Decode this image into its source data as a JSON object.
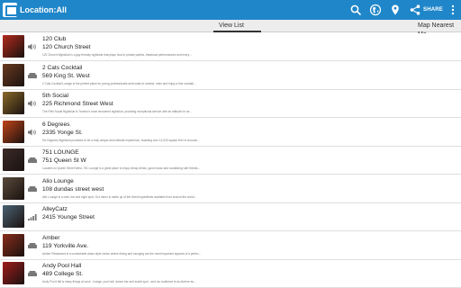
{
  "app_title": "Location:All",
  "toolbar": {
    "share_label": "SHARE"
  },
  "tabs": [
    {
      "label": "View List",
      "selected": true
    },
    {
      "label": "Map Nearest Me",
      "selected": false
    }
  ],
  "listings": [
    {
      "name": "120 Club",
      "address": "120 Church Street",
      "description": "120 Church Nightclub is a gay friendly nightclub that plays host to private parties, theatrical performances and every...",
      "type_icon": "speaker-icon",
      "thumb_color": "#b22a1c"
    },
    {
      "name": "2 Cats Cocktail",
      "address": "569 King St. West",
      "description": "2 Cats Cocktail Lounge is the perfect place for young professionals and locals to unwind, relax and enjoy a fine cocktail...",
      "type_icon": "sofa-icon",
      "thumb_color": "#6a3a20"
    },
    {
      "name": "5th Social",
      "address": "225 Richmond Street West",
      "description": "The Fifth Social Nightclub is Toronto's most renowned nightclub, providing exceptional service with an attitude for se...",
      "type_icon": "speaker-icon",
      "thumb_color": "#8a6a2a"
    },
    {
      "name": "6 Degrees",
      "address": "2335 Yonge St.",
      "description": "Six Degrees Nightclub promises to be a truly unique and intimate experience, boasting over 12,000 square feet of chocola...",
      "type_icon": "speaker-icon",
      "thumb_color": "#c04418"
    },
    {
      "name": "751 LOUNGE",
      "address": "751 Queen St W",
      "description": "Located on Queen Street West, 751 Lounge is a great place to enjoy cheap drinks, good music and socializing with friends...",
      "type_icon": "sofa-icon",
      "thumb_color": "#3c2a28"
    },
    {
      "name": "Alio Lounge",
      "address": "108 dundas street west",
      "description": "Alio Lounge is a cafe, bar and night spot. Our menu is made up of the finest ingredients available from around the world...",
      "type_icon": "sofa-icon",
      "thumb_color": "#5a4a3a"
    },
    {
      "name": "AlleyCatz",
      "address": "2415 Younge Street",
      "description": "",
      "type_icon": "signal-bars-icon",
      "thumb_color": "#4a6272"
    },
    {
      "name": "Amber",
      "address": "119 Yorkville Ave.",
      "description": "Amber Restaurant is a comfortable Asian style venue where dining and lounging are the most important aspects of a perfec...",
      "type_icon": "sofa-icon",
      "thumb_color": "#8a2c1a"
    },
    {
      "name": "Andy Pool Hall",
      "address": "489 College St.",
      "description": "Andy Pool Hall is many things at once - lounge, pool hall, dance bar and social spot - and our audience is as diverse as...",
      "type_icon": "sofa-icon",
      "thumb_color": "#a01c1c"
    }
  ]
}
